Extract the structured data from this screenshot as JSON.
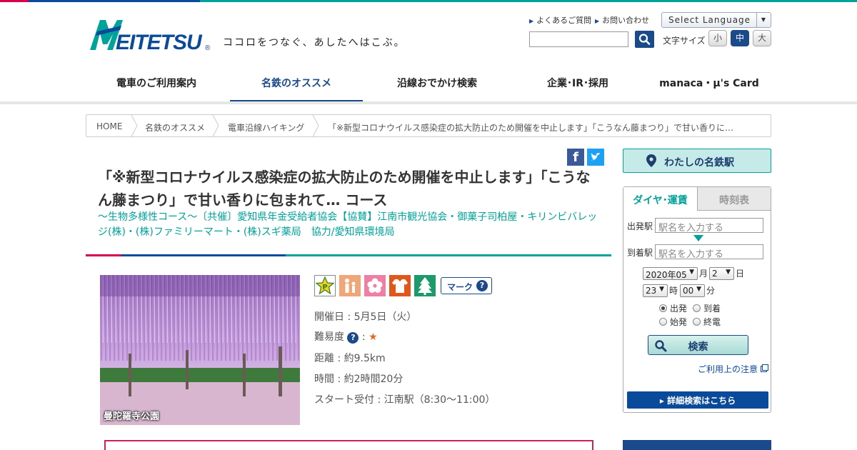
{
  "header": {
    "logo_text": "MEITETSU",
    "tagline": "ココロをつなぐ、あしたへはこぶ。",
    "util_links": [
      "よくあるご質問",
      "お問い合わせ"
    ],
    "language_select": "Select Language",
    "font_size_label": "文字サイズ",
    "font_sizes": [
      "小",
      "中",
      "大"
    ],
    "font_size_selected": "中",
    "search_value": ""
  },
  "nav": {
    "items": [
      "電車のご利用案内",
      "名鉄のオススメ",
      "沿線おでかけ検索",
      "企業･IR･採用",
      "manaca・μ's Card"
    ],
    "active": "名鉄のオススメ"
  },
  "breadcrumb": [
    "HOME",
    "名鉄のオススメ",
    "電車沿線ハイキング",
    "「※新型コロナウイルス感染症の拡大防止のため開催を中止します」「こうなん藤まつり」で甘い香りに…"
  ],
  "course": {
    "title": "「※新型コロナウイルス感染症の拡大防止のため開催を中止します」「こうなん藤まつり」で甘い香りに包まれて… コース",
    "subtitle": "～生物多様性コース～〔共催〕愛知県年金受給者協会【協賛】江南市観光協会・御菓子司柏屋・キリンビバレッジ(株)・(株)ファミリーマート・(株)スギ薬局　協力/愛知県環境局",
    "photo_caption": "曼陀羅寺公園",
    "mark_button": "マーク",
    "date": "開催日 : 5月5日（火）",
    "difficulty_label": "難易度",
    "difficulty_stars": "★",
    "distance": "距離 : 約9.5km",
    "duration": "時間 : 約2時間20分",
    "start": "スタート受付 : 江南駅（8:30～11:00）"
  },
  "sidebar": {
    "my_station": "わたしの名鉄駅",
    "tabs": [
      "ダイヤ･運賃",
      "時刻表"
    ],
    "active_tab": "ダイヤ･運賃",
    "from_label": "出発駅",
    "to_label": "到着駅",
    "station_placeholder": "駅名を入力する",
    "year_month": "2020年05",
    "month_unit": "月",
    "day": "2",
    "day_unit": "日",
    "hour": "23",
    "hour_unit": "時",
    "minute": "00",
    "minute_unit": "分",
    "radios": [
      "出発",
      "到着",
      "始発",
      "終電"
    ],
    "radio_selected": "出発",
    "search_button": "検索",
    "note_link": "ご利用上の注意",
    "detail_button": "詳細検索はこちら"
  },
  "colors": {
    "brand_blue": "#1b4a8a",
    "brand_teal": "#00a29a",
    "accent_pink": "#d7004f"
  }
}
